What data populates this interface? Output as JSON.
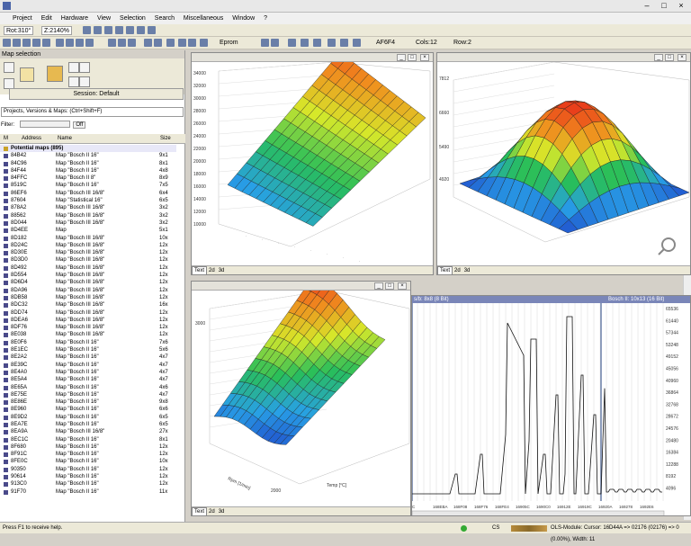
{
  "menu": [
    "Project",
    "Edit",
    "Hardware",
    "View",
    "Selection",
    "Search",
    "Miscellaneous",
    "Window",
    "?"
  ],
  "toolbar": {
    "rot": "Rot:310°",
    "zoom": "Z:2140%",
    "eprom": "Eprom",
    "af": "AF6F4",
    "cols": "Cols:12",
    "row": "Row:2"
  },
  "left_panel": {
    "title": "Map selection",
    "session_label": "Session: Default",
    "project_select": "Projects, Versions & Maps: (Ctrl+Shift+F)",
    "filter_label": "Filter:",
    "filter_off": "Off",
    "columns": {
      "m": "M",
      "address": "Address",
      "name": "Name",
      "size": "Size"
    },
    "group": "Potential maps (895)",
    "rows": [
      {
        "addr": "84B42",
        "name": "Map \"Bosch II 16\"",
        "size": "9x1"
      },
      {
        "addr": "84C96",
        "name": "Map \"Bosch II 16\"",
        "size": "8x1"
      },
      {
        "addr": "84F44",
        "name": "Map \"Bosch II 16\"",
        "size": "4x8"
      },
      {
        "addr": "84FFC",
        "name": "Map \"Bosch II 8\"",
        "size": "8x9"
      },
      {
        "addr": "8519C",
        "name": "Map \"Bosch II 16\"",
        "size": "7x5"
      },
      {
        "addr": "86EF6",
        "name": "Map \"Bosch III 16/8\"",
        "size": "6x4"
      },
      {
        "addr": "87604",
        "name": "Map \"Statistical 16\"",
        "size": "6x5"
      },
      {
        "addr": "878A2",
        "name": "Map \"Bosch III 16/8\"",
        "size": "3x2"
      },
      {
        "addr": "88562",
        "name": "Map \"Bosch III 16/8\"",
        "size": "3x2"
      },
      {
        "addr": "8D044",
        "name": "Map \"Bosch III 16/8\"",
        "size": "3x2"
      },
      {
        "addr": "8D4EE",
        "name": "Map",
        "size": "5x1"
      },
      {
        "addr": "8D182",
        "name": "Map \"Bosch III 16/8\"",
        "size": "10x"
      },
      {
        "addr": "8D24C",
        "name": "Map \"Bosch III 16/8\"",
        "size": "12x"
      },
      {
        "addr": "8D30E",
        "name": "Map \"Bosch III 16/8\"",
        "size": "12x"
      },
      {
        "addr": "8D3D0",
        "name": "Map \"Bosch III 16/8\"",
        "size": "12x"
      },
      {
        "addr": "8D492",
        "name": "Map \"Bosch III 16/8\"",
        "size": "12x"
      },
      {
        "addr": "8D554",
        "name": "Map \"Bosch III 16/8\"",
        "size": "12x"
      },
      {
        "addr": "8D6D4",
        "name": "Map \"Bosch III 16/8\"",
        "size": "12x"
      },
      {
        "addr": "8DA96",
        "name": "Map \"Bosch III 16/8\"",
        "size": "12x"
      },
      {
        "addr": "8DB58",
        "name": "Map \"Bosch III 16/8\"",
        "size": "12x"
      },
      {
        "addr": "8DC32",
        "name": "Map \"Bosch III 16/8\"",
        "size": "16x"
      },
      {
        "addr": "8DD74",
        "name": "Map \"Bosch III 16/8\"",
        "size": "12x"
      },
      {
        "addr": "8DEA6",
        "name": "Map \"Bosch III 16/8\"",
        "size": "12x"
      },
      {
        "addr": "8DF76",
        "name": "Map \"Bosch III 16/8\"",
        "size": "12x"
      },
      {
        "addr": "8E038",
        "name": "Map \"Bosch III 16/8\"",
        "size": "12x"
      },
      {
        "addr": "8E0F6",
        "name": "Map \"Bosch II 16\"",
        "size": "7x6"
      },
      {
        "addr": "8E1EC",
        "name": "Map \"Bosch II 16\"",
        "size": "5x6"
      },
      {
        "addr": "8E2A2",
        "name": "Map \"Bosch II 16\"",
        "size": "4x7"
      },
      {
        "addr": "8E39C",
        "name": "Map \"Bosch II 16\"",
        "size": "4x7"
      },
      {
        "addr": "8E4A0",
        "name": "Map \"Bosch II 16\"",
        "size": "4x7"
      },
      {
        "addr": "8E5A4",
        "name": "Map \"Bosch II 16\"",
        "size": "4x7"
      },
      {
        "addr": "8E65A",
        "name": "Map \"Bosch II 16\"",
        "size": "4x6"
      },
      {
        "addr": "8E75E",
        "name": "Map \"Bosch II 16\"",
        "size": "4x7"
      },
      {
        "addr": "8E86E",
        "name": "Map \"Bosch II 16\"",
        "size": "9x8"
      },
      {
        "addr": "8E960",
        "name": "Map \"Bosch II 16\"",
        "size": "6x6"
      },
      {
        "addr": "8E9D2",
        "name": "Map \"Bosch II 16\"",
        "size": "6x5"
      },
      {
        "addr": "8EA7E",
        "name": "Map \"Bosch II 16\"",
        "size": "6x5"
      },
      {
        "addr": "8EA9A",
        "name": "Map \"Bosch III 16/8\"",
        "size": "27x"
      },
      {
        "addr": "8EC1C",
        "name": "Map \"Bosch II 16\"",
        "size": "8x1"
      },
      {
        "addr": "8F680",
        "name": "Map \"Bosch II 16\"",
        "size": "12x"
      },
      {
        "addr": "8F91C",
        "name": "Map \"Bosch II 16\"",
        "size": "12x"
      },
      {
        "addr": "8FE0C",
        "name": "Map \"Bosch II 16\"",
        "size": "10x"
      },
      {
        "addr": "90350",
        "name": "Map \"Bosch II 16\"",
        "size": "12x"
      },
      {
        "addr": "90614",
        "name": "Map \"Bosch II 16\"",
        "size": "12x"
      },
      {
        "addr": "913C0",
        "name": "Map \"Bosch II 16\"",
        "size": "12x"
      },
      {
        "addr": "91F70",
        "name": "Map \"Bosch II 16\"",
        "size": "11x"
      }
    ]
  },
  "pane1": {
    "zticks": [
      "34000",
      "32000",
      "30000",
      "28000",
      "26000",
      "24000",
      "22000",
      "20000",
      "18000",
      "16000",
      "14000",
      "12000",
      "10000"
    ],
    "tabs": [
      "Text",
      "2d",
      "3d"
    ]
  },
  "pane2": {
    "zticks": [
      "7812",
      "6660",
      "5490",
      "4920"
    ],
    "tabs": [
      "Text",
      "2d",
      "3d"
    ]
  },
  "pane3": {
    "ztick": "3000",
    "xlabel": "Temp [°C]",
    "ylabel": "Rpm [1/min]",
    "ytick": "2000",
    "tabs": [
      "Text",
      "2d",
      "3d"
    ]
  },
  "pane4": {
    "header_left": "s/b: 8x8 (8 Bit)",
    "header_right": "Bosch II: 10x13 (16 Bit)",
    "yticks": [
      "65536",
      "61440",
      "57344",
      "53248",
      "49152",
      "45056",
      "40960",
      "36864",
      "32768",
      "28672",
      "24576",
      "20480",
      "16384",
      "12288",
      "8192",
      "4096"
    ],
    "xticks": [
      "C",
      "168EBA",
      "168F08",
      "168F76",
      "168FE4",
      "16905C",
      "1690C0",
      "16912E",
      "16919C",
      "16920A",
      "169278",
      "1692E6"
    ]
  },
  "status": {
    "help": "Press F1 to receive help.",
    "cs": "CS",
    "module": "OLS-Module: Cursor: 16D44A => 02176 (02176) => 0 (0.00%), Width: 11"
  },
  "colors": {
    "surface_high": "#e8301a",
    "surface_mid": "#d6e82a",
    "surface_low": "#1f3fc8"
  }
}
